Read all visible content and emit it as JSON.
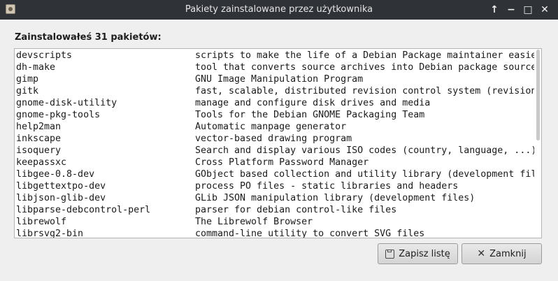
{
  "window": {
    "title": "Pakiety zainstalowane przez użytkownika",
    "buttons": {
      "restore": "↑",
      "minimize": "−",
      "maximize": "□",
      "close": "✕"
    }
  },
  "heading": "Zainstalowałeś 31 pakietów:",
  "packages": [
    {
      "name": "devscripts",
      "description": "scripts to make the life of a Debian Package maintainer easier"
    },
    {
      "name": "dh-make",
      "description": "tool that converts source archives into Debian package source"
    },
    {
      "name": "gimp",
      "description": "GNU Image Manipulation Program"
    },
    {
      "name": "gitk",
      "description": "fast, scalable, distributed revision control system (revision tree visualizer)"
    },
    {
      "name": "gnome-disk-utility",
      "description": "manage and configure disk drives and media"
    },
    {
      "name": "gnome-pkg-tools",
      "description": "Tools for the Debian GNOME Packaging Team"
    },
    {
      "name": "help2man",
      "description": "Automatic manpage generator"
    },
    {
      "name": "inkscape",
      "description": "vector-based drawing program"
    },
    {
      "name": "isoquery",
      "description": "Search and display various ISO codes (country, language, ...)"
    },
    {
      "name": "keepassxc",
      "description": "Cross Platform Password Manager"
    },
    {
      "name": "libgee-0.8-dev",
      "description": "GObject based collection and utility library (development files)"
    },
    {
      "name": "libgettextpo-dev",
      "description": "process PO files - static libraries and headers"
    },
    {
      "name": "libjson-glib-dev",
      "description": "GLib JSON manipulation library (development files)"
    },
    {
      "name": "libparse-debcontrol-perl",
      "description": "parser for debian control-like files"
    },
    {
      "name": "librewolf",
      "description": "The Librewolf Browser"
    },
    {
      "name": "librsvg2-bin",
      "description": "command-line utility to convert SVG files"
    }
  ],
  "buttons": {
    "save": "Zapisz listę",
    "close": "Zamknij"
  },
  "icons": {
    "app": "package-icon",
    "save": "floppy-disk-icon",
    "close": "close-x-icon"
  }
}
